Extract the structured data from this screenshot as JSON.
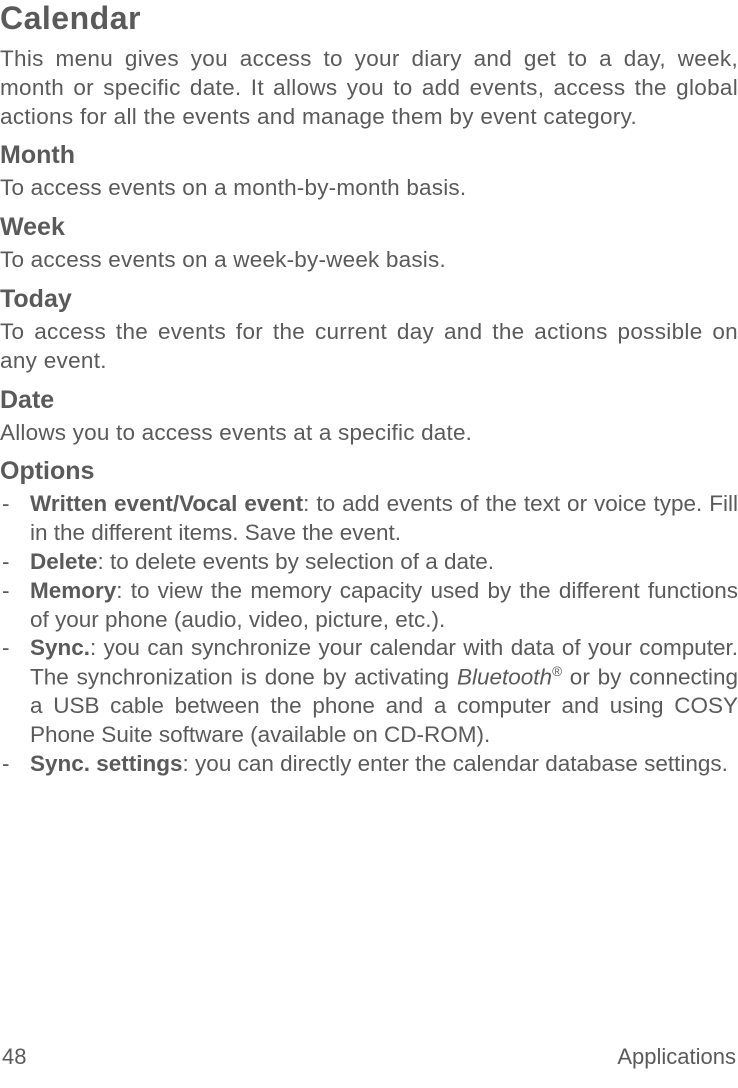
{
  "title": "Calendar",
  "intro": "This menu gives you access to your diary and get to a day, week, month or specific date. It allows you to add events, access the global actions for all the events and manage them by event category.",
  "sections": {
    "month": {
      "heading": "Month",
      "body": "To access events on a month-by-month basis."
    },
    "week": {
      "heading": "Week",
      "body": "To access events on a week-by-week basis."
    },
    "today": {
      "heading": "Today",
      "body": "To access the events for the current day and the actions possible on any event."
    },
    "date": {
      "heading": "Date",
      "body": "Allows you to access events at a specific date."
    },
    "options": {
      "heading": "Options"
    }
  },
  "options_items": [
    {
      "label": "Written event/Vocal event",
      "rest": ": to add events of the text or voice type. Fill in the different items. Save the event."
    },
    {
      "label": "Delete",
      "rest": ": to delete events by selection of a date."
    },
    {
      "label": "Memory",
      "rest": ": to view the memory capacity used by the different functions of your phone (audio, video, picture, etc.)."
    },
    {
      "label": "Sync.",
      "rest_pre": ": you can synchronize your calendar with data of your computer. The synchronization is done by activating ",
      "italic_word": "Bluetooth",
      "sup": "®",
      "rest_post": " or by connecting a USB cable between the phone and a computer and using COSY Phone Suite software (available on CD-ROM)."
    },
    {
      "label": "Sync.  settings",
      "rest": ": you can directly enter the calendar database settings."
    }
  ],
  "footer": {
    "page": "48",
    "section": "Applications"
  },
  "bullet": "-"
}
